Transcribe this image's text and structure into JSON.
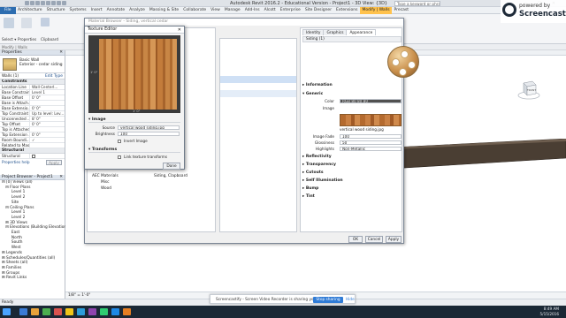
{
  "window": {
    "title": "Autodesk Revit 2016.2 - Educational Version -   Project1 - 3D View: {3D}",
    "search_placeholder": "Type a keyword or phrase",
    "controls": [
      "—",
      "☐",
      "✕"
    ]
  },
  "ribbon_tabs": [
    "File",
    "Architecture",
    "Structure",
    "Systems",
    "Insert",
    "Annotate",
    "Analyze",
    "Massing & Site",
    "Collaborate",
    "View",
    "Manage",
    "Add-Ins",
    "Alcott",
    "Enterprise",
    "Site Designer",
    "Extensions",
    "Modify | Walls",
    "Precast"
  ],
  "ribbon": {
    "select_label": "Select ▾",
    "properties_label": "Properties",
    "clipboard_label": "Clipboard"
  },
  "modify_bar": "Modify | Walls",
  "properties": {
    "title": "Properties",
    "close": "✕",
    "type_line1": "Basic Wall",
    "type_line2": "Exterior - cedar siding",
    "filter": "Walls (1)",
    "edit_type": "Edit Type",
    "groups": {
      "constraints": "Constraints",
      "structural": "Structural"
    },
    "rows": [
      {
        "k": "Location Line",
        "v": "Wall Centerl..."
      },
      {
        "k": "Base Constraint",
        "v": "Level 1"
      },
      {
        "k": "Base Offset",
        "v": "0' 0\""
      },
      {
        "k": "Base is Attach...",
        "v": ""
      },
      {
        "k": "Base Extensio...",
        "v": "0' 0\""
      },
      {
        "k": "Top Constraint",
        "v": "Up to level: Lev..."
      },
      {
        "k": "Unconnected ...",
        "v": "8' 0\""
      },
      {
        "k": "Top Offset",
        "v": "0' 0\""
      },
      {
        "k": "Top is Attached",
        "v": ""
      },
      {
        "k": "Top Extension ...",
        "v": "0' 0\""
      },
      {
        "k": "Room Boundi...",
        "v": "✓"
      },
      {
        "k": "Related to Mass",
        "v": ""
      }
    ],
    "structural_row": {
      "k": "Structural",
      "v": ""
    },
    "help": "Properties help",
    "apply": "Apply"
  },
  "browser": {
    "title": "Project Browser - Project1",
    "close": "✕",
    "items": [
      "⊟ [0] Views (all)",
      "   ⊟ Floor Plans",
      "        Level 1",
      "        Level 2",
      "        Site",
      "   ⊟ Ceiling Plans",
      "        Level 1",
      "        Level 2",
      "   ⊞ 3D Views",
      "   ⊟ Elevations (Building Elevation)",
      "        East",
      "        North",
      "        South",
      "        West",
      "⊞ Legends",
      "⊞ Schedules/Quantities (all)",
      "⊞ Sheets (all)",
      "⊞ Families",
      "⊞ Groups",
      "⊞ Revit Links"
    ]
  },
  "material_browser": {
    "title": "Material Browser - Siding, vertical cedar",
    "asset_tabs": [
      "Identity",
      "Graphics",
      "Appearance"
    ],
    "active_tab": "Appearance",
    "asset_name": "Siding (1)",
    "sections": {
      "information": "▸ Information",
      "generic": "▾ Generic",
      "reflectivity": "▸ Reflectivity",
      "transparency": "▸ Transparency",
      "cutouts": "▸ Cutouts",
      "self_illumination": "▸ Self Illumination",
      "bump": "▸ Bump",
      "tint": "▸ Tint"
    },
    "generic": {
      "color_label": "Color",
      "color_value": "RGB 80 80 80",
      "image_label": "Image",
      "image_file": "vertical wood siding.jpg",
      "image_fade_label": "Image Fade",
      "image_fade_value": "100",
      "glossiness_label": "Glossiness",
      "glossiness_value": "50",
      "highlights_label": "Highlights",
      "highlights_value": "Non-Metallic"
    },
    "library": {
      "folder": "AEC Materials",
      "items": [
        "Misc",
        "Wood"
      ],
      "selected_material": "Siding, Clapboard"
    },
    "buttons": {
      "ok": "OK",
      "cancel": "Cancel",
      "apply": "Apply"
    }
  },
  "texture_editor": {
    "title": "Texture Editor",
    "close": "✕",
    "dim_height": "1' 0\"",
    "dim_width": "1' 0\"",
    "image_section": "▾ Image",
    "source_label": "Source",
    "source_value": "vertical wood siding.jpg",
    "brightness_label": "Brightness",
    "brightness_value": "100",
    "invert_label": "Invert Image",
    "transforms_section": "▾ Transforms",
    "link_label": "Link texture transforms",
    "done": "Done"
  },
  "viewcube": {
    "face": "FRONT"
  },
  "view_bar": {
    "scale": "1/8\" = 1'-0\""
  },
  "status": {
    "text": "Ready"
  },
  "screencastify": {
    "banner_text": "Screencastify - Screen Video Recorder is sharing your screen.",
    "stop": "Stop sharing",
    "hide": "Hide",
    "watermark_line1": "powered by",
    "watermark_line2": "Screencastify"
  },
  "taskbar": {
    "time": "8:49 AM",
    "date": "5/15/2016",
    "icon_colors": [
      "#3a7bd5",
      "#e8a23a",
      "#4caf50",
      "#d9534f",
      "#f0c419",
      "#2b9cd8",
      "#8e44ad",
      "#2ecc71",
      "#1e88e5",
      "#e67e22"
    ]
  }
}
